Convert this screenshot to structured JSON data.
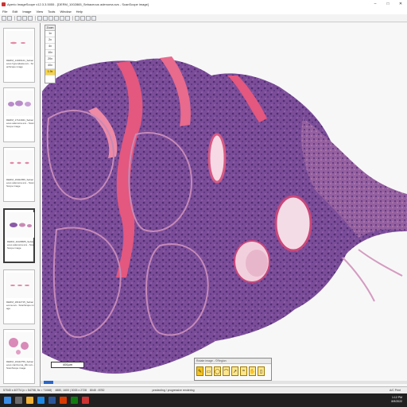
{
  "window": {
    "title": "Aperio ImageScope v12.3.3.5055 - [DERM_1002865_Sebaceous adenoma.svs - ScanScope image]",
    "controls": [
      "–",
      "□",
      "✕"
    ]
  },
  "menu": [
    "File",
    "Edit",
    "Image",
    "View",
    "Tools",
    "Window",
    "Help"
  ],
  "thumbnails": [
    {
      "label": "DERM_14049121_Sebaceous hyperplasia.svs - ScanScope image"
    },
    {
      "label": "DERM_17124941_Sebaceous adenoma.svs - ScanScope image"
    },
    {
      "label": "DERM_16022056_Sebaceous adenoma.svs - ScanScope image"
    },
    {
      "label": "DERM_11028685_Sebaceous adenoma.svs - ScanScope image"
    },
    {
      "label": "DERM_18132715_Sebaceoma.svs - ScanScope image"
    },
    {
      "label": "DERM_19442759_Sebaceous carcinoma_40x.svs - ScanScope image"
    }
  ],
  "zoom": {
    "label": "Zoom",
    "levels": [
      "1x",
      "2x",
      "4x",
      "10x",
      "20x",
      "40x",
      "1.9x"
    ],
    "active_index": 6
  },
  "scalebar": {
    "label": "400µm"
  },
  "annotation_panel": {
    "title": "Rotate image - ©Region",
    "tools": [
      "✎",
      "▭",
      "◯",
      "⌒",
      "↗",
      "≈",
      "✋",
      "▯"
    ]
  },
  "status": {
    "dims": "57040 x 40774 (x = 54798, 9x = 71068)",
    "region": "4880, 1600 | 3033 x 2728",
    "mag": "8045 : 8782",
    "mode": "predecting / progressive rendering",
    "right": "A/C  Print"
  },
  "taskbar": {
    "time": "1:12 PM",
    "date": "8/9/2022"
  },
  "colors": {
    "accent": "#2b66c7",
    "zoom_active": "#f6d44a",
    "tissue_pink": "#e46c8c",
    "tissue_purple": "#6a3f8a"
  }
}
